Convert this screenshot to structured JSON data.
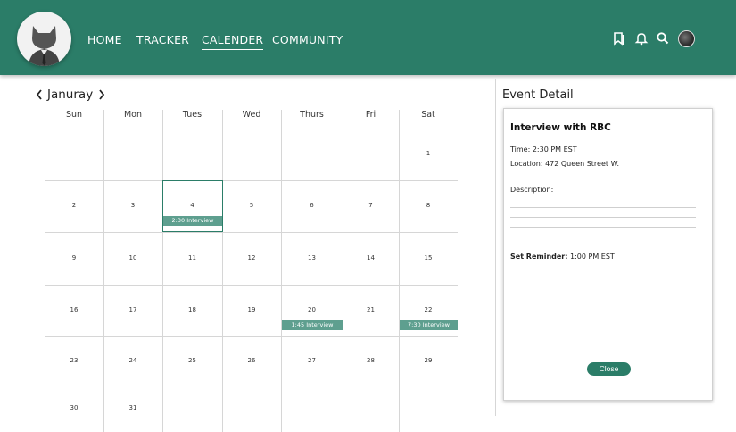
{
  "nav": {
    "items": [
      {
        "label": "HOME"
      },
      {
        "label": "TRACKER"
      },
      {
        "label": "CALENDER"
      },
      {
        "label": "COMMUNITY"
      }
    ],
    "active": "CALENDER"
  },
  "header_icons": [
    "bookmark-icon",
    "bell-icon",
    "search-icon",
    "avatar"
  ],
  "colors": {
    "brand": "#2b7d68",
    "event": "#5e9f8f"
  },
  "calendar": {
    "month": "Januray",
    "weekdays": [
      "Sun",
      "Mon",
      "Tues",
      "Wed",
      "Thurs",
      "Fri",
      "Sat"
    ],
    "weeks": [
      [
        "",
        "",
        "",
        "",
        "",
        "",
        "1"
      ],
      [
        "2",
        "3",
        "4",
        "5",
        "6",
        "7",
        "8"
      ],
      [
        "9",
        "10",
        "11",
        "12",
        "13",
        "14",
        "15"
      ],
      [
        "16",
        "17",
        "18",
        "19",
        "20",
        "21",
        "22"
      ],
      [
        "23",
        "24",
        "25",
        "26",
        "27",
        "28",
        "29"
      ],
      [
        "30",
        "31",
        "",
        "",
        "",
        "",
        ""
      ]
    ],
    "selected_day": "4",
    "events": [
      {
        "day": "4",
        "label": "2:30 Interview"
      },
      {
        "day": "20",
        "label": "1:45 Interview"
      },
      {
        "day": "22",
        "label": "7:30 Interview"
      }
    ]
  },
  "event_detail": {
    "panel_title": "Event Detail",
    "title": "Interview with RBC",
    "time": "Time: 2:30 PM EST",
    "location": "Location: 472 Queen Street W.",
    "description_label": "Description:",
    "reminder_label": "Set Reminder:",
    "reminder_value": "1:00 PM EST",
    "close_label": "Close"
  }
}
